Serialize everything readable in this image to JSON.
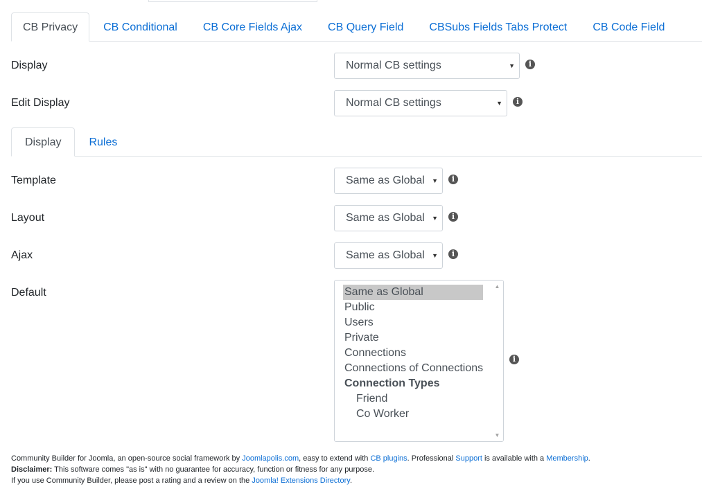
{
  "top_tabs": [
    {
      "label": "CB Privacy",
      "active": true
    },
    {
      "label": "CB Conditional",
      "active": false
    },
    {
      "label": "CB Core Fields Ajax",
      "active": false
    },
    {
      "label": "CB Query Field",
      "active": false
    },
    {
      "label": "CBSubs Fields Tabs Protect",
      "active": false
    },
    {
      "label": "CB Code Field",
      "active": false
    }
  ],
  "fields": {
    "display": {
      "label": "Display",
      "value": "Normal CB settings"
    },
    "edit_display": {
      "label": "Edit Display",
      "value": "Normal CB settings"
    },
    "template": {
      "label": "Template",
      "value": "Same as Global"
    },
    "layout": {
      "label": "Layout",
      "value": "Same as Global"
    },
    "ajax": {
      "label": "Ajax",
      "value": "Same as Global"
    },
    "default": {
      "label": "Default"
    }
  },
  "sub_tabs": [
    {
      "label": "Display",
      "active": true
    },
    {
      "label": "Rules",
      "active": false
    }
  ],
  "default_list": {
    "options": [
      "Same as Global",
      "Public",
      "Users",
      "Private",
      "Connections",
      "Connections of Connections"
    ],
    "selected": "Same as Global",
    "group_label": "Connection Types",
    "group_options": [
      "Friend",
      "Co Worker"
    ]
  },
  "footer": {
    "line1_a": "Community Builder for Joomla, an open-source social framework by ",
    "line1_link1": "Joomlapolis.com",
    "line1_b": ", easy to extend with ",
    "line1_link2": "CB plugins",
    "line1_c": ". Professional ",
    "line1_link3": "Support",
    "line1_d": " is available with a ",
    "line1_link4": "Membership",
    "line1_e": ".",
    "line2_bold": "Disclaimer:",
    "line2_text": " This software comes \"as is\" with no guarantee for accuracy, function or fitness for any purpose.",
    "line3_a": "If you use Community Builder, please post a rating and a review on the ",
    "line3_link": "Joomla! Extensions Directory",
    "line3_b": "."
  },
  "icons": {
    "info": "info-circle-icon",
    "caret": "caret-down-icon"
  }
}
